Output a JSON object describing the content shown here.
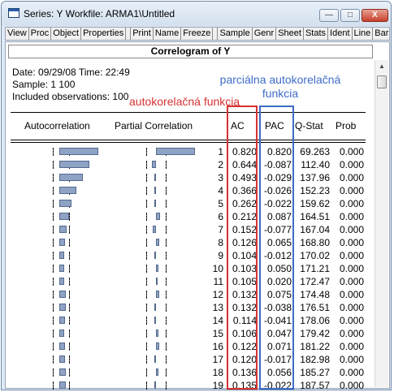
{
  "window": {
    "title": "Series: Y   Workfile: ARMA1\\Untitled",
    "controls": {
      "minimize": "—",
      "maximize": "□",
      "close": "X"
    }
  },
  "toolbar": [
    "View",
    "Proc",
    "Object",
    "Properties",
    "Print",
    "Name",
    "Freeze",
    "Sample",
    "Genr",
    "Sheet",
    "Stats",
    "Ident",
    "Line",
    "Bar"
  ],
  "view": {
    "header": "Correlogram of Y",
    "date_line": "Date: 09/29/08   Time: 22:49",
    "sample_line": "Sample: 1 100",
    "obs_line": "Included observations: 100",
    "columns": {
      "autocorrelation": "Autocorrelation",
      "partial": "Partial Correlation",
      "ac": "AC",
      "pac": "PAC",
      "qstat": "Q-Stat",
      "prob": "Prob"
    }
  },
  "annotations": {
    "pac_label": "parciálna autokorelačná funkcia",
    "ac_label": "autokorelačná funkcia",
    "ac_color": "#d63232",
    "pac_color": "#3e6cc8"
  },
  "correlogram": [
    {
      "lag": "1",
      "ac": "0.820",
      "pac": "0.820",
      "q": "69.263",
      "prob": "0.000"
    },
    {
      "lag": "2",
      "ac": "0.644",
      "pac": "-0.087",
      "q": "112.40",
      "prob": "0.000"
    },
    {
      "lag": "3",
      "ac": "0.493",
      "pac": "-0.029",
      "q": "137.96",
      "prob": "0.000"
    },
    {
      "lag": "4",
      "ac": "0.366",
      "pac": "-0.026",
      "q": "152.23",
      "prob": "0.000"
    },
    {
      "lag": "5",
      "ac": "0.262",
      "pac": "-0.022",
      "q": "159.62",
      "prob": "0.000"
    },
    {
      "lag": "6",
      "ac": "0.212",
      "pac": "0.087",
      "q": "164.51",
      "prob": "0.000"
    },
    {
      "lag": "7",
      "ac": "0.152",
      "pac": "-0.077",
      "q": "167.04",
      "prob": "0.000"
    },
    {
      "lag": "8",
      "ac": "0.126",
      "pac": "0.065",
      "q": "168.80",
      "prob": "0.000"
    },
    {
      "lag": "9",
      "ac": "0.104",
      "pac": "-0.012",
      "q": "170.02",
      "prob": "0.000"
    },
    {
      "lag": "10",
      "ac": "0.103",
      "pac": "0.050",
      "q": "171.21",
      "prob": "0.000"
    },
    {
      "lag": "11",
      "ac": "0.105",
      "pac": "0.020",
      "q": "172.47",
      "prob": "0.000"
    },
    {
      "lag": "12",
      "ac": "0.132",
      "pac": "0.075",
      "q": "174.48",
      "prob": "0.000"
    },
    {
      "lag": "13",
      "ac": "0.132",
      "pac": "-0.038",
      "q": "176.51",
      "prob": "0.000"
    },
    {
      "lag": "14",
      "ac": "0.114",
      "pac": "-0.041",
      "q": "178.06",
      "prob": "0.000"
    },
    {
      "lag": "15",
      "ac": "0.106",
      "pac": "0.047",
      "q": "179.42",
      "prob": "0.000"
    },
    {
      "lag": "16",
      "ac": "0.122",
      "pac": "0.071",
      "q": "181.22",
      "prob": "0.000"
    },
    {
      "lag": "17",
      "ac": "0.120",
      "pac": "-0.017",
      "q": "182.98",
      "prob": "0.000"
    },
    {
      "lag": "18",
      "ac": "0.136",
      "pac": "0.056",
      "q": "185.27",
      "prob": "0.000"
    },
    {
      "lag": "19",
      "ac": "0.135",
      "pac": "-0.022",
      "q": "187.57",
      "prob": "0.000"
    }
  ]
}
